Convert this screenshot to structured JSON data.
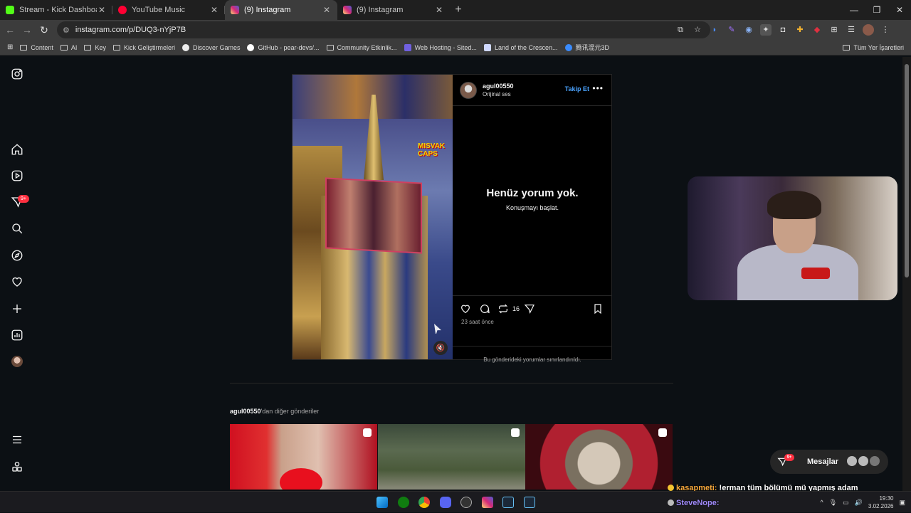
{
  "tabs": [
    {
      "title": "Stream - Kick Dashboard",
      "color": "#53fc18",
      "active": false
    },
    {
      "title": "YouTube Music",
      "color": "#ff0033",
      "active": false
    },
    {
      "title": "(9) Instagram",
      "color": "#d62976",
      "active": true
    },
    {
      "title": "(9) Instagram",
      "color": "#d62976",
      "active": false
    }
  ],
  "address": {
    "url": "instagram.com/p/DUQ3-nYjP7B"
  },
  "bookmarks": {
    "items": [
      "Content",
      "AI",
      "Key",
      "Kick Geliştirmeleri",
      "Discover Games",
      "GitHub - pear-devs/...",
      "Community Etkinlik...",
      "Web Hosting - Sited...",
      "Land of the Crescen...",
      "腾讯混元3D"
    ],
    "all": "Tüm Yer İşaretleri"
  },
  "sidebar": {
    "notif_badge": "9+"
  },
  "post": {
    "username": "agul00550",
    "audio": "Orijinal ses",
    "follow": "Takip Et",
    "no_comments": "Henüz yorum yok.",
    "start_conv": "Konuşmayı başlat.",
    "repost_count": "16",
    "time_ago": "23 saat önce",
    "comments_limited": "Bu gönderideki yorumlar sınırlandırıldı.",
    "media_logo": "MISVAK CAPS"
  },
  "more_posts": {
    "username": "agul00550",
    "suffix": "'dan diğer gönderiler"
  },
  "messages": {
    "label": "Mesajlar",
    "badge": "9+"
  },
  "chat": [
    {
      "name": "kasapmeti:",
      "text": "!erman tüm bölümü mü yapmış adam",
      "color": "#f4a63a"
    },
    {
      "name": "SteveNope:",
      "text": "",
      "color": "#a28cff"
    }
  ],
  "taskbar": {
    "time": "19:30",
    "date": "3.02.2026"
  }
}
